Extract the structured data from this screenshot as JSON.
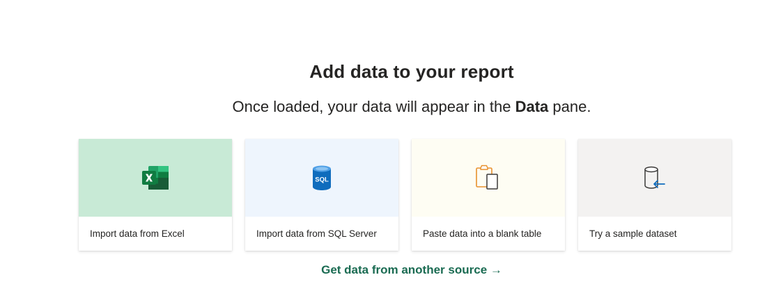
{
  "header": {
    "title": "Add data to your report",
    "subtitle_before": "Once loaded, your data will appear in the ",
    "subtitle_bold": "Data",
    "subtitle_after": " pane."
  },
  "cards": [
    {
      "label": "Import data from Excel",
      "icon": "excel-icon",
      "bg": "#c8ead6"
    },
    {
      "label": "Import data from SQL Server",
      "icon": "sql-server-icon",
      "bg": "#eef5fd"
    },
    {
      "label": "Paste data into a blank table",
      "icon": "clipboard-paste-icon",
      "bg": "#fefdf3"
    },
    {
      "label": "Try a sample dataset",
      "icon": "sample-dataset-icon",
      "bg": "#f3f2f1"
    }
  ],
  "cta": {
    "label": "Get data from another source",
    "arrow": "→"
  }
}
